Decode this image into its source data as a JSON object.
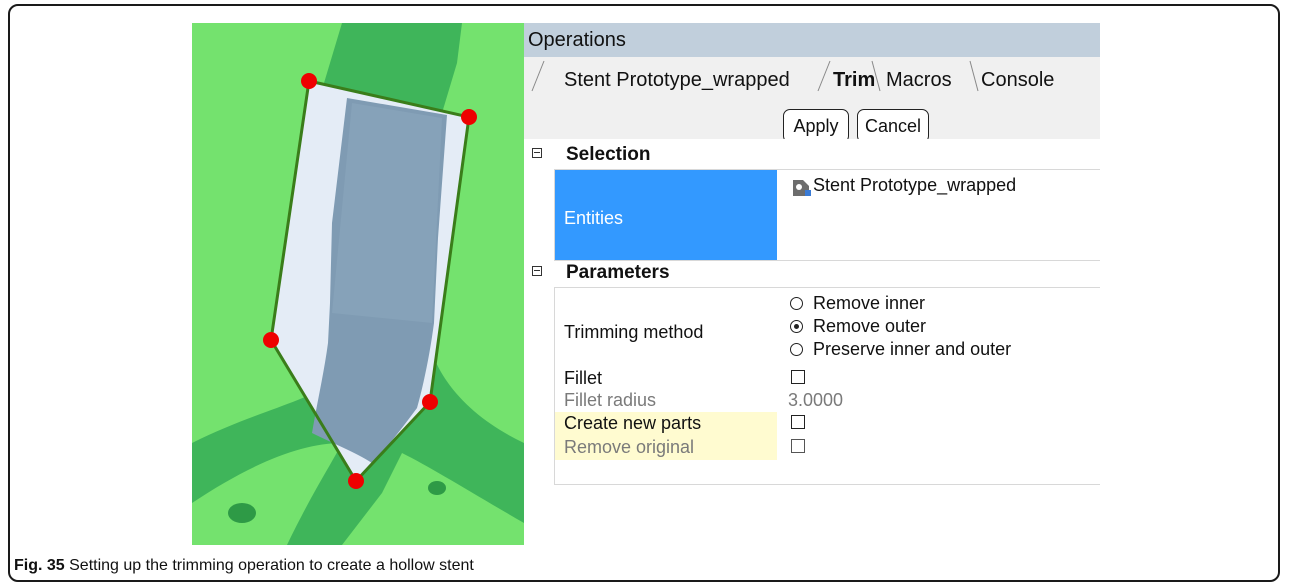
{
  "caption": {
    "label": "Fig. 35",
    "text": " Setting up the trimming operation to create a hollow stent"
  },
  "panel": {
    "title": "Operations",
    "tabs": [
      {
        "label": "Stent Prototype_wrapped",
        "active": false
      },
      {
        "label": "Trim",
        "active": true
      },
      {
        "label": "Macros",
        "active": false
      },
      {
        "label": "Console",
        "active": false
      }
    ],
    "apply_label": "Apply",
    "cancel_label": "Cancel"
  },
  "selection": {
    "header": "Selection",
    "entities_label": "Entities",
    "entity_name": "Stent Prototype_wrapped",
    "entity_icon": "part-icon"
  },
  "parameters": {
    "header": "Parameters",
    "trimming_method_label": "Trimming method",
    "trimming_options": [
      {
        "label": "Remove inner",
        "selected": false
      },
      {
        "label": "Remove outer",
        "selected": true
      },
      {
        "label": "Preserve inner and outer",
        "selected": false
      }
    ],
    "fillet_label": "Fillet",
    "fillet_checked": false,
    "fillet_radius_label": "Fillet radius",
    "fillet_radius_value": "3.0000",
    "create_new_parts_label": "Create new parts",
    "create_new_parts_checked": false,
    "remove_original_label": "Remove original",
    "remove_original_checked": false
  },
  "colors": {
    "background_green": "#74e26e",
    "vessel_green": "#3fb55a",
    "stent_blue": "#7f9bb3",
    "trim_polygon_fill": "#e4ecf6",
    "trim_edge": "#3a7d1a",
    "control_point": "#ee0000",
    "selection_highlight": "#3399ff",
    "highlight_yellow": "#fffbd0",
    "header_bg": "#c1cfdc"
  }
}
